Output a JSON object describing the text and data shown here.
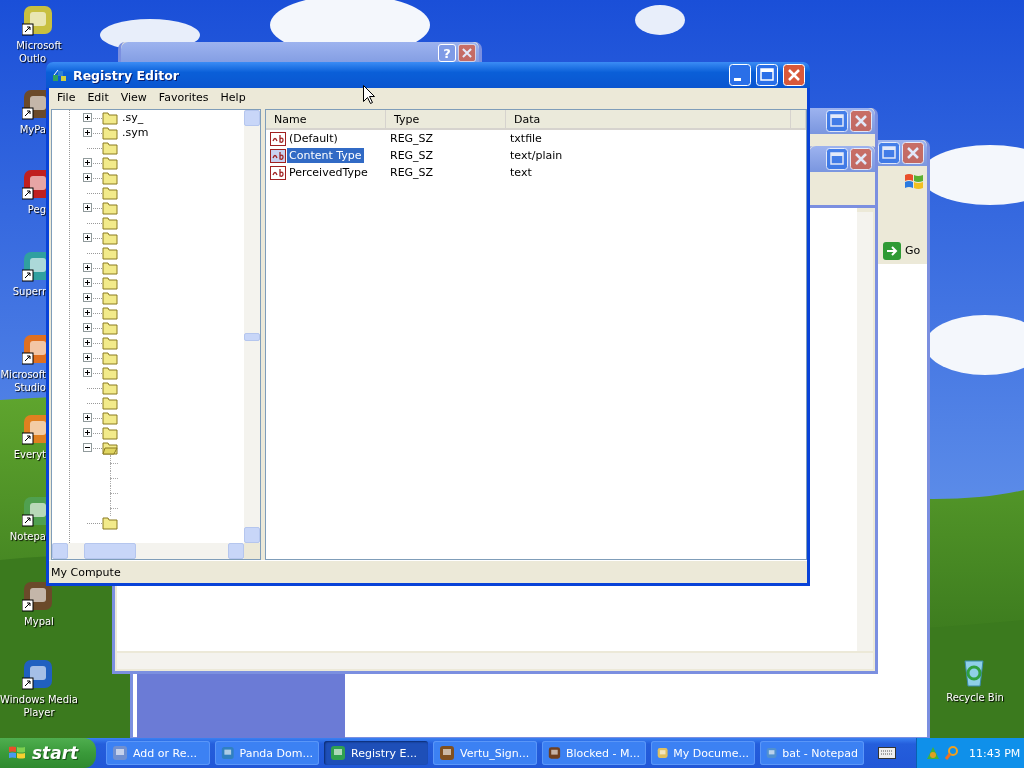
{
  "desktop_icons": [
    {
      "lines": [
        "Microsoft",
        "Outlo"
      ]
    },
    {
      "lines": [
        "MyPa"
      ]
    },
    {
      "lines": [
        "Peg"
      ]
    },
    {
      "lines": [
        "Superr"
      ]
    },
    {
      "lines": [
        "Microsoft",
        "Studio"
      ]
    },
    {
      "lines": [
        "Everyt"
      ]
    },
    {
      "lines": [
        "Notepa"
      ]
    },
    {
      "lines": [
        "Mypal"
      ]
    },
    {
      "lines": [
        "Windows Media",
        "Player"
      ]
    },
    {
      "lines": [
        "Recycle Bin"
      ]
    }
  ],
  "background_windows": [
    {
      "kind": "explorer",
      "go_button": "Go"
    },
    {
      "kind": "dialog",
      "help_button": "?"
    },
    {
      "kind": "editor"
    },
    {
      "kind": "small"
    }
  ],
  "registry_editor": {
    "title": "Registry Editor",
    "menu": [
      "File",
      "Edit",
      "View",
      "Favorites",
      "Help"
    ],
    "tree": [
      {
        "label": ".sy_",
        "expandable": true,
        "expanded": false
      },
      {
        "label": ".sym",
        "expandable": true,
        "expanded": false
      },
      {
        "expandable": false,
        "expanded": false
      },
      {
        "expandable": true,
        "expanded": false
      },
      {
        "expandable": true,
        "expanded": false
      },
      {
        "expandable": false,
        "expanded": false
      },
      {
        "expandable": true,
        "expanded": false
      },
      {
        "expandable": false,
        "expanded": false
      },
      {
        "expandable": true,
        "expanded": false
      },
      {
        "expandable": false,
        "expanded": false
      },
      {
        "expandable": true,
        "expanded": false
      },
      {
        "expandable": true,
        "expanded": false
      },
      {
        "expandable": true,
        "expanded": false
      },
      {
        "expandable": true,
        "expanded": false
      },
      {
        "expandable": true,
        "expanded": false
      },
      {
        "expandable": true,
        "expanded": false
      },
      {
        "expandable": true,
        "expanded": false
      },
      {
        "expandable": true,
        "expanded": false
      },
      {
        "expandable": false,
        "expanded": false
      },
      {
        "expandable": false,
        "expanded": false
      },
      {
        "expandable": true,
        "expanded": false
      },
      {
        "expandable": true,
        "expanded": false
      },
      {
        "expandable": true,
        "expanded": true,
        "children": [
          {
            "kind": "blank"
          },
          {
            "kind": "blank"
          },
          {
            "kind": "blank"
          },
          {
            "kind": "blank"
          }
        ]
      },
      {
        "expandable": false,
        "expanded": false
      }
    ],
    "columns": [
      "Name",
      "Type",
      "Data"
    ],
    "values": [
      {
        "name": "(Default)",
        "type": "REG_SZ",
        "data": "txtfile",
        "selected": false
      },
      {
        "name": "Content Type",
        "type": "REG_SZ",
        "data": "text/plain",
        "selected": true
      },
      {
        "name": "PerceivedType",
        "type": "REG_SZ",
        "data": "text",
        "selected": false
      }
    ],
    "status_bar": "My Compute"
  },
  "taskbar": {
    "start": "start",
    "tasks": [
      {
        "label": "Add or Re...",
        "selected": false
      },
      {
        "label": "Panda Dom...",
        "selected": false
      },
      {
        "label": "Registry E...",
        "selected": true
      },
      {
        "label": "Vertu_Sign...",
        "selected": false
      },
      {
        "label": "Blocked - M...",
        "selected": false
      },
      {
        "label": "My Docume...",
        "selected": false
      },
      {
        "label": "bat - Notepad",
        "selected": false
      }
    ],
    "clock": "11:43 PM"
  }
}
